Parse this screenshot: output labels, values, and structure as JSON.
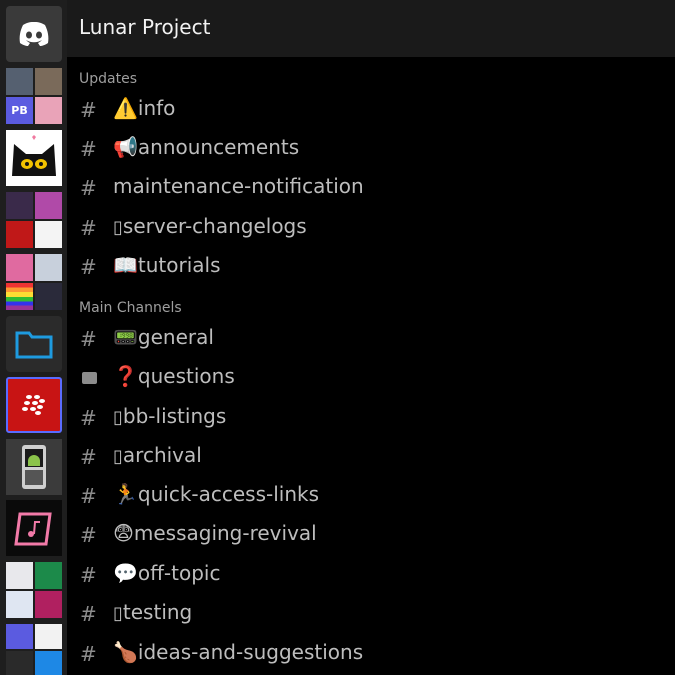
{
  "header": {
    "title": "Lunar Project"
  },
  "servers": [
    {
      "name": "discord-home"
    },
    {
      "name": "server-avatar-cluster-1",
      "text": "PB"
    },
    {
      "name": "server-cat"
    },
    {
      "name": "server-avatar-cluster-2"
    },
    {
      "name": "server-avatar-cluster-3"
    },
    {
      "name": "server-folder"
    },
    {
      "name": "server-blackberry"
    },
    {
      "name": "server-android-phone"
    },
    {
      "name": "server-music"
    },
    {
      "name": "server-avatar-cluster-4"
    },
    {
      "name": "server-avatar-cluster-5"
    }
  ],
  "categories": [
    {
      "label": "Updates"
    },
    {
      "label": "Main Channels"
    }
  ],
  "channels": [
    {
      "icon": "#",
      "emoji": "⚠️",
      "label": "info"
    },
    {
      "icon": "#",
      "emoji": "📢",
      "label": "announcements"
    },
    {
      "icon": "#",
      "emoji": "",
      "label": "maintenance-notification"
    },
    {
      "icon": "#",
      "emoji": "",
      "label": "server-changelogs"
    },
    {
      "icon": "#",
      "emoji": "📖",
      "label": "tutorials"
    },
    {
      "icon": "#",
      "emoji": "📟",
      "label": "general"
    },
    {
      "icon": "forum",
      "emoji": "❓",
      "label": "questions"
    },
    {
      "icon": "#",
      "emoji": "",
      "label": "bb-listings"
    },
    {
      "icon": "#",
      "emoji": "",
      "label": "archival"
    },
    {
      "icon": "#",
      "emoji": "🏃",
      "label": "quick-access-links"
    },
    {
      "icon": "#",
      "emoji": "😨",
      "label": "messaging-revival"
    },
    {
      "icon": "#",
      "emoji": "💬",
      "label": "off-topic"
    },
    {
      "icon": "#",
      "emoji": "",
      "label": "testing"
    },
    {
      "icon": "#",
      "emoji": "🍗",
      "label": "ideas-and-suggestions"
    }
  ]
}
